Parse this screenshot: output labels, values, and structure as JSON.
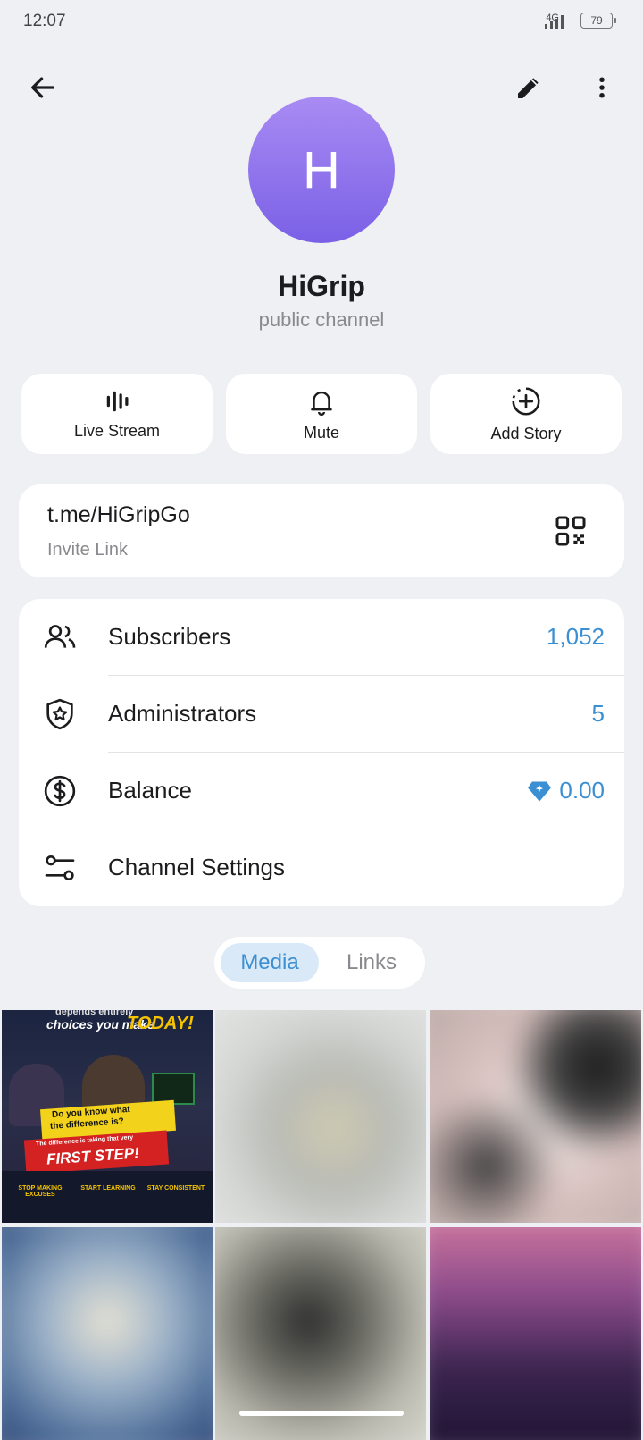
{
  "status_bar": {
    "time": "12:07",
    "network": "4G",
    "battery": "79"
  },
  "header": {
    "back_icon": "arrow-left-icon",
    "edit_icon": "pencil-icon",
    "more_icon": "more-vert-icon"
  },
  "profile": {
    "avatar_letter": "H",
    "name": "HiGrip",
    "subtitle": "public channel"
  },
  "actions": [
    {
      "label": "Live Stream",
      "icon": "live-stream-icon"
    },
    {
      "label": "Mute",
      "icon": "bell-icon"
    },
    {
      "label": "Add Story",
      "icon": "add-story-icon"
    }
  ],
  "invite": {
    "link": "t.me/HiGripGo",
    "caption": "Invite Link",
    "icon": "qr-code-icon"
  },
  "info_rows": [
    {
      "label": "Subscribers",
      "value": "1,052",
      "icon": "people-icon"
    },
    {
      "label": "Administrators",
      "value": "5",
      "icon": "shield-star-icon"
    },
    {
      "label": "Balance",
      "value": "0.00",
      "icon": "dollar-icon"
    },
    {
      "label": "Channel Settings",
      "value": "",
      "icon": "sliders-icon"
    }
  ],
  "tabs": {
    "media": "Media",
    "links": "Links"
  },
  "poster": {
    "top": "depends entirely",
    "line1": "choices you make",
    "today": "TODAY!",
    "q1": "Do you know what",
    "q2": "the difference is?",
    "diff": "The difference is taking that very",
    "step": "FIRST STEP!",
    "c1": "STOP MAKING EXCUSES",
    "c2": "START LEARNING",
    "c3": "STAY CONSISTENT"
  },
  "colors": {
    "accent": "#3b8fd3",
    "avatar_top": "#a98bf3",
    "avatar_bottom": "#7a60e6",
    "background": "#eff0f3"
  }
}
